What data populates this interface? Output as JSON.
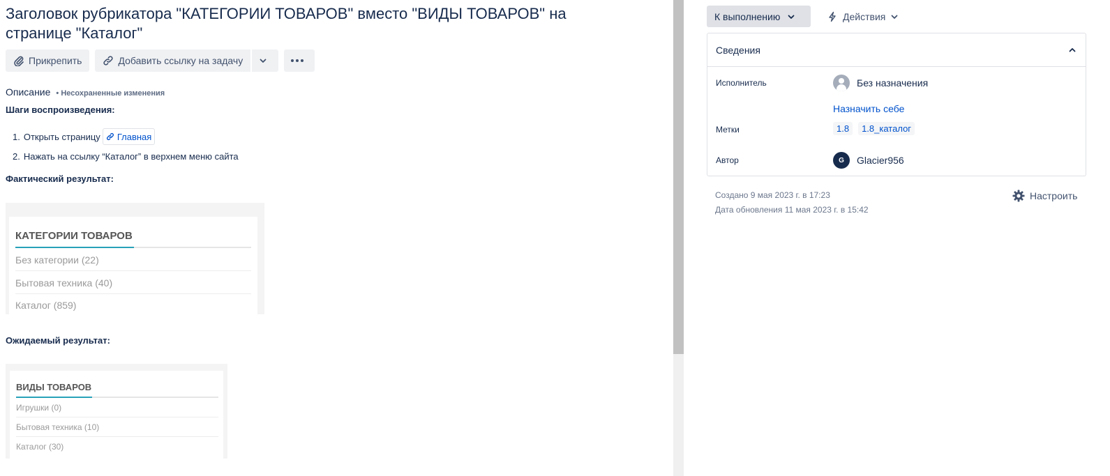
{
  "issue": {
    "title": "Заголовок рубрикатора \"КАТЕГОРИИ ТОВАРОВ\" вместо \"ВИДЫ ТОВАРОВ\" на странице \"Каталог\""
  },
  "toolbar": {
    "attach_label": "Прикрепить",
    "add_link_label": "Добавить ссылку на задачу"
  },
  "description": {
    "label": "Описание",
    "unsaved": "Несохраненные изменения",
    "steps_heading": "Шаги воспроизведения:",
    "steps": [
      {
        "num": "1.",
        "text": "Открыть страницу",
        "link": "Главная"
      },
      {
        "num": "2.",
        "text": "Нажать на ссылку “Каталог” в верхнем меню сайта"
      }
    ],
    "actual_heading": "Фактический результат:",
    "expected_heading": "Ожидаемый результат:",
    "actual_image": {
      "heading": "КАТЕГОРИИ ТОВАРОВ",
      "rows": [
        "Без категории (22)",
        "Бытовая техника (40)",
        "Каталог (859)"
      ]
    },
    "expected_image": {
      "heading": "ВИДЫ ТОВАРОВ",
      "rows": [
        "Игрушки (0)",
        "Бытовая техника (10)",
        "Каталог (30)"
      ]
    }
  },
  "sidebar": {
    "status_label": "К выполнению",
    "actions_label": "Действия",
    "details": {
      "title": "Сведения",
      "assignee_label": "Исполнитель",
      "assignee_value": "Без назначения",
      "assign_self": "Назначить себе",
      "labels_label": "Метки",
      "labels": [
        "1.8",
        "1.8_каталог"
      ],
      "reporter_label": "Автор",
      "reporter_initial": "G",
      "reporter_name": "Glacier956"
    },
    "created": "Создано 9 мая 2023 г. в 17:23",
    "updated": "Дата обновления 11 мая 2023 г. в 15:42",
    "configure_label": "Настроить"
  },
  "colors": {
    "link": "#0052cc",
    "text": "#172b4d",
    "accent_underline": "#28a1b9"
  }
}
